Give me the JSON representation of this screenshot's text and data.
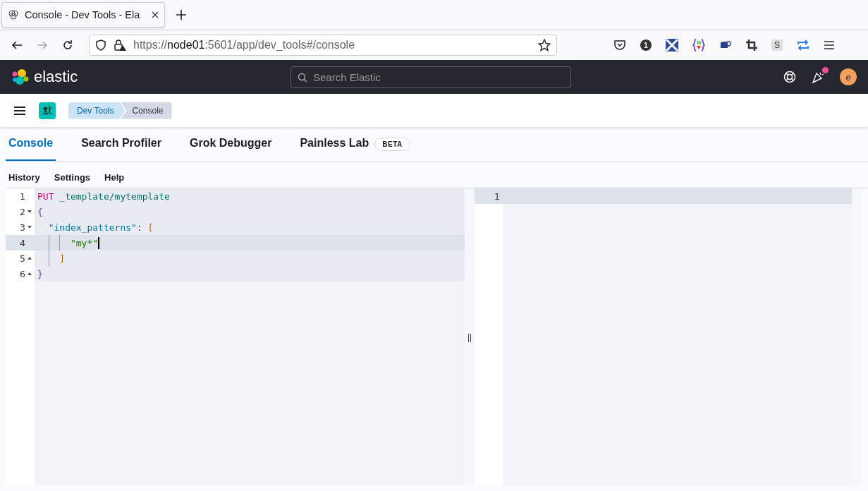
{
  "browser": {
    "tab": {
      "title": "Console - Dev Tools - Ela",
      "selected": true
    },
    "url": {
      "scheme": "https://",
      "host": "node01",
      "rest": ":5601/app/dev_tools#/console"
    },
    "extension_badge": "1",
    "extension_letter": "S"
  },
  "header": {
    "logo": "elastic",
    "search": {
      "placeholder": "Search Elastic"
    },
    "notification": true,
    "avatar": "e"
  },
  "breadcrumbs": [
    {
      "label": "Dev Tools",
      "selected": false
    },
    {
      "label": "Console",
      "selected": true
    }
  ],
  "space_badge": "默",
  "tabs": [
    {
      "label": "Console",
      "selected": true
    },
    {
      "label": "Search Profiler",
      "selected": false
    },
    {
      "label": "Grok Debugger",
      "selected": false
    },
    {
      "label": "Painless Lab",
      "selected": false,
      "badge": "BETA"
    }
  ],
  "menu": [
    "History",
    "Settings",
    "Help"
  ],
  "editor": {
    "lines": [
      {
        "number": "1",
        "fold_start": false,
        "fold_end": false,
        "active": false,
        "tokens": [
          {
            "kind": "method",
            "text": "PUT"
          },
          {
            "kind": "url",
            "text": " _template/mytemplate"
          }
        ]
      },
      {
        "number": "2",
        "fold_start": true,
        "fold_end": false,
        "active": false,
        "tokens": [
          {
            "kind": "paren",
            "text": "{"
          }
        ]
      },
      {
        "number": "3",
        "fold_start": true,
        "fold_end": false,
        "active": false,
        "tokens": [
          {
            "kind": "key",
            "text": "  \"index_patterns\""
          },
          {
            "kind": "plain",
            "text": ": "
          },
          {
            "kind": "bracket",
            "text": "["
          }
        ]
      },
      {
        "number": "4",
        "fold_start": false,
        "fold_end": false,
        "active": true,
        "tokens": [
          {
            "kind": "string",
            "text": "      \"my*\""
          }
        ]
      },
      {
        "number": "5",
        "fold_start": false,
        "fold_end": true,
        "active": false,
        "tokens": [
          {
            "kind": "bracket",
            "text": "    ]"
          }
        ]
      },
      {
        "number": "6",
        "fold_start": false,
        "fold_end": true,
        "active": false,
        "tokens": [
          {
            "kind": "paren",
            "text": "}"
          }
        ]
      }
    ]
  },
  "output": {
    "lines": [
      {
        "number": "1"
      }
    ]
  },
  "resizer": "||"
}
